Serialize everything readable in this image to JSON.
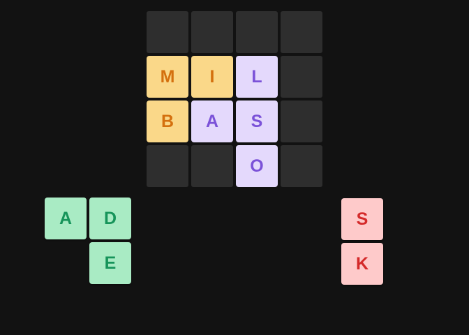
{
  "colors": {
    "background": "#121212",
    "empty_cell": "#2e2e2e",
    "yellow_bg": "#fad889",
    "yellow_fg": "#d4700e",
    "purple_bg": "#e4d9fc",
    "purple_fg": "#7b52d8",
    "green_bg": "#a9ebc4",
    "green_fg": "#16945a",
    "red_bg": "#fecaca",
    "red_fg": "#d42a2a"
  },
  "board": {
    "size": 4,
    "cells": [
      [
        "",
        "",
        "",
        ""
      ],
      [
        "M",
        "I",
        "L",
        ""
      ],
      [
        "B",
        "A",
        "S",
        ""
      ],
      [
        "",
        "",
        "O",
        ""
      ]
    ],
    "cell_colors": [
      [
        "empty",
        "empty",
        "empty",
        "empty"
      ],
      [
        "yellow",
        "yellow",
        "purple",
        "empty"
      ],
      [
        "yellow",
        "purple",
        "purple",
        "empty"
      ],
      [
        "empty",
        "empty",
        "purple",
        "empty"
      ]
    ]
  },
  "tray": {
    "green_piece": {
      "color": "green",
      "letters": [
        "A",
        "D",
        "E"
      ]
    },
    "red_piece": {
      "color": "red",
      "letters": [
        "S",
        "K"
      ]
    }
  }
}
